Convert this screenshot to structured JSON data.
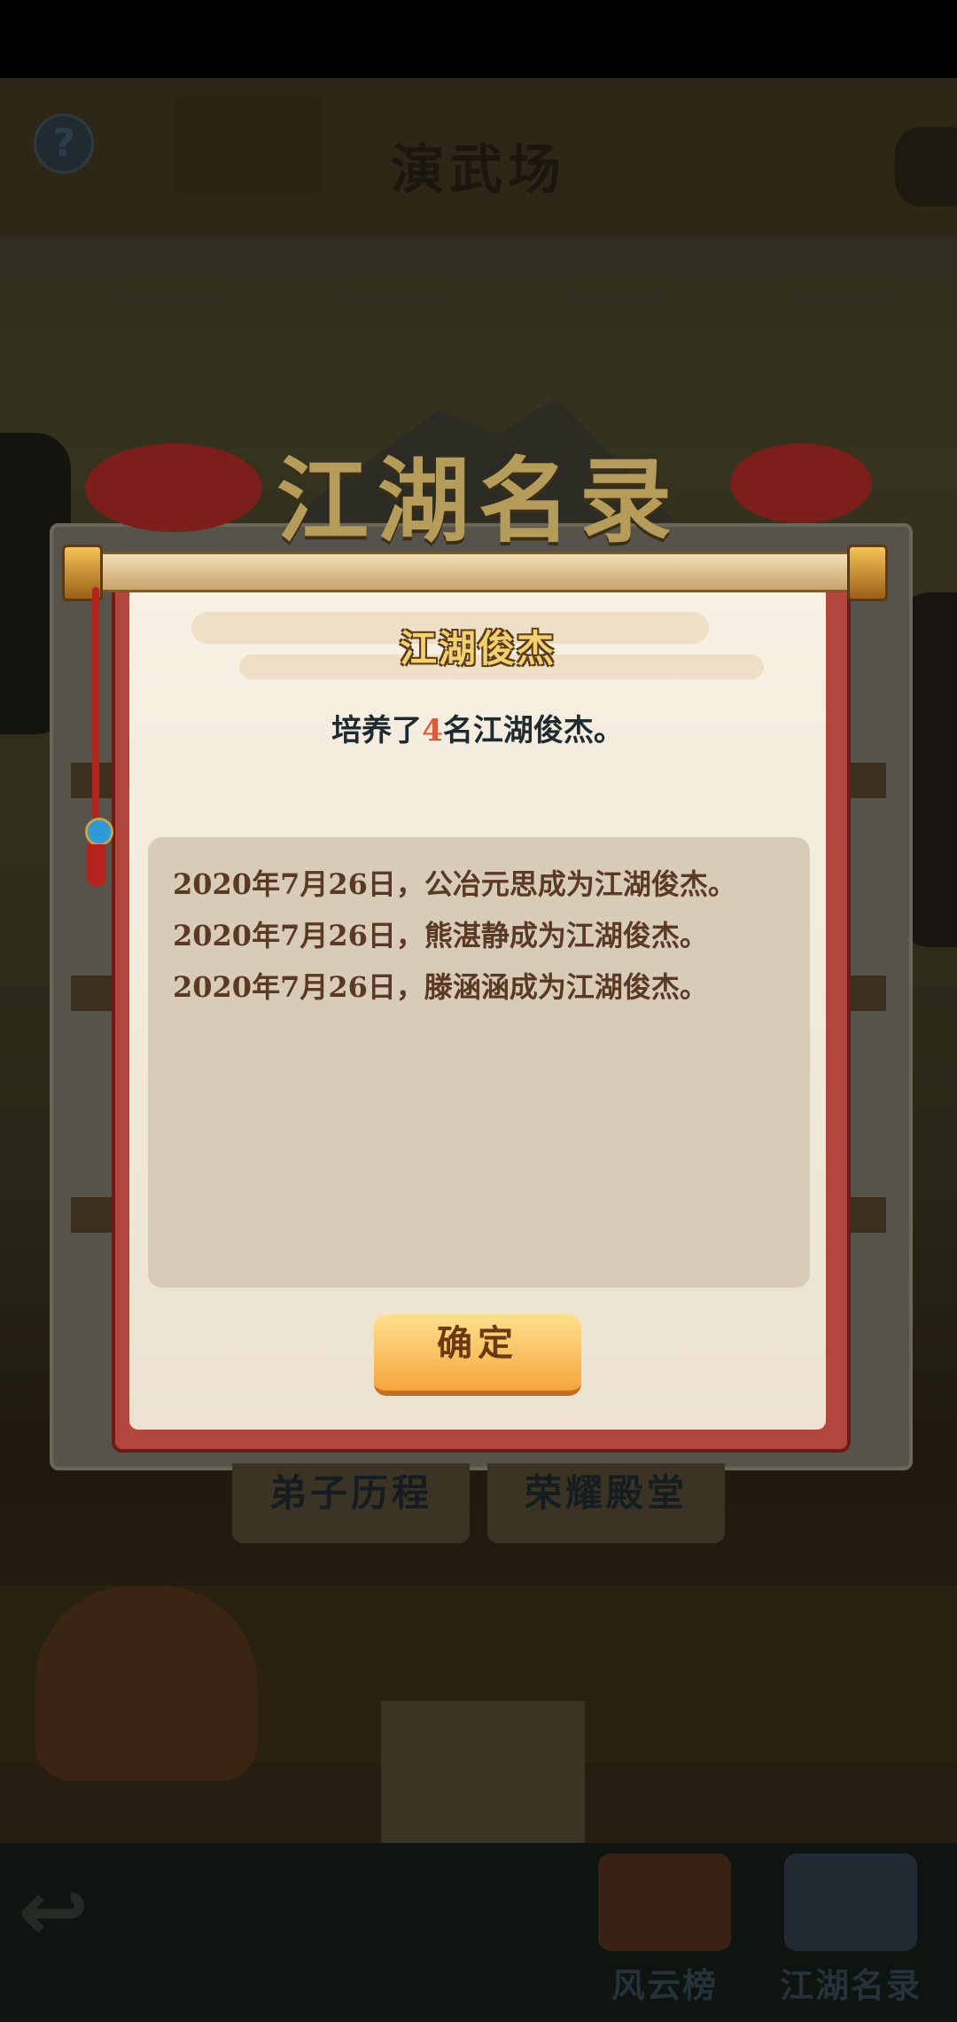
{
  "background": {
    "scene_title": "演武场",
    "help_icon_glyph": "?",
    "tabs": [
      "弟子历程",
      "荣耀殿堂"
    ],
    "bottom_nav": [
      {
        "label": "风云榜",
        "icon": "ranking-scroll-icon"
      },
      {
        "label": "江湖名录",
        "icon": "book-icon"
      }
    ],
    "back_icon": "back-arrow-icon"
  },
  "modal": {
    "banner_title": "江湖名录",
    "section_title": "江湖俊杰",
    "summary": {
      "prefix": "培养了",
      "count": "4",
      "suffix": "名江湖俊杰。"
    },
    "records": [
      "2020年7月26日，公冶元思成为江湖俊杰。",
      "2020年7月26日，熊湛静成为江湖俊杰。",
      "2020年7月26日，滕涵涵成为江湖俊杰。"
    ],
    "confirm_label": "确定"
  },
  "colors": {
    "accent_number": "#e05a3a",
    "button_top": "#ffe08e",
    "button_bottom": "#f5a63d",
    "scroll_border": "#b3463c"
  }
}
